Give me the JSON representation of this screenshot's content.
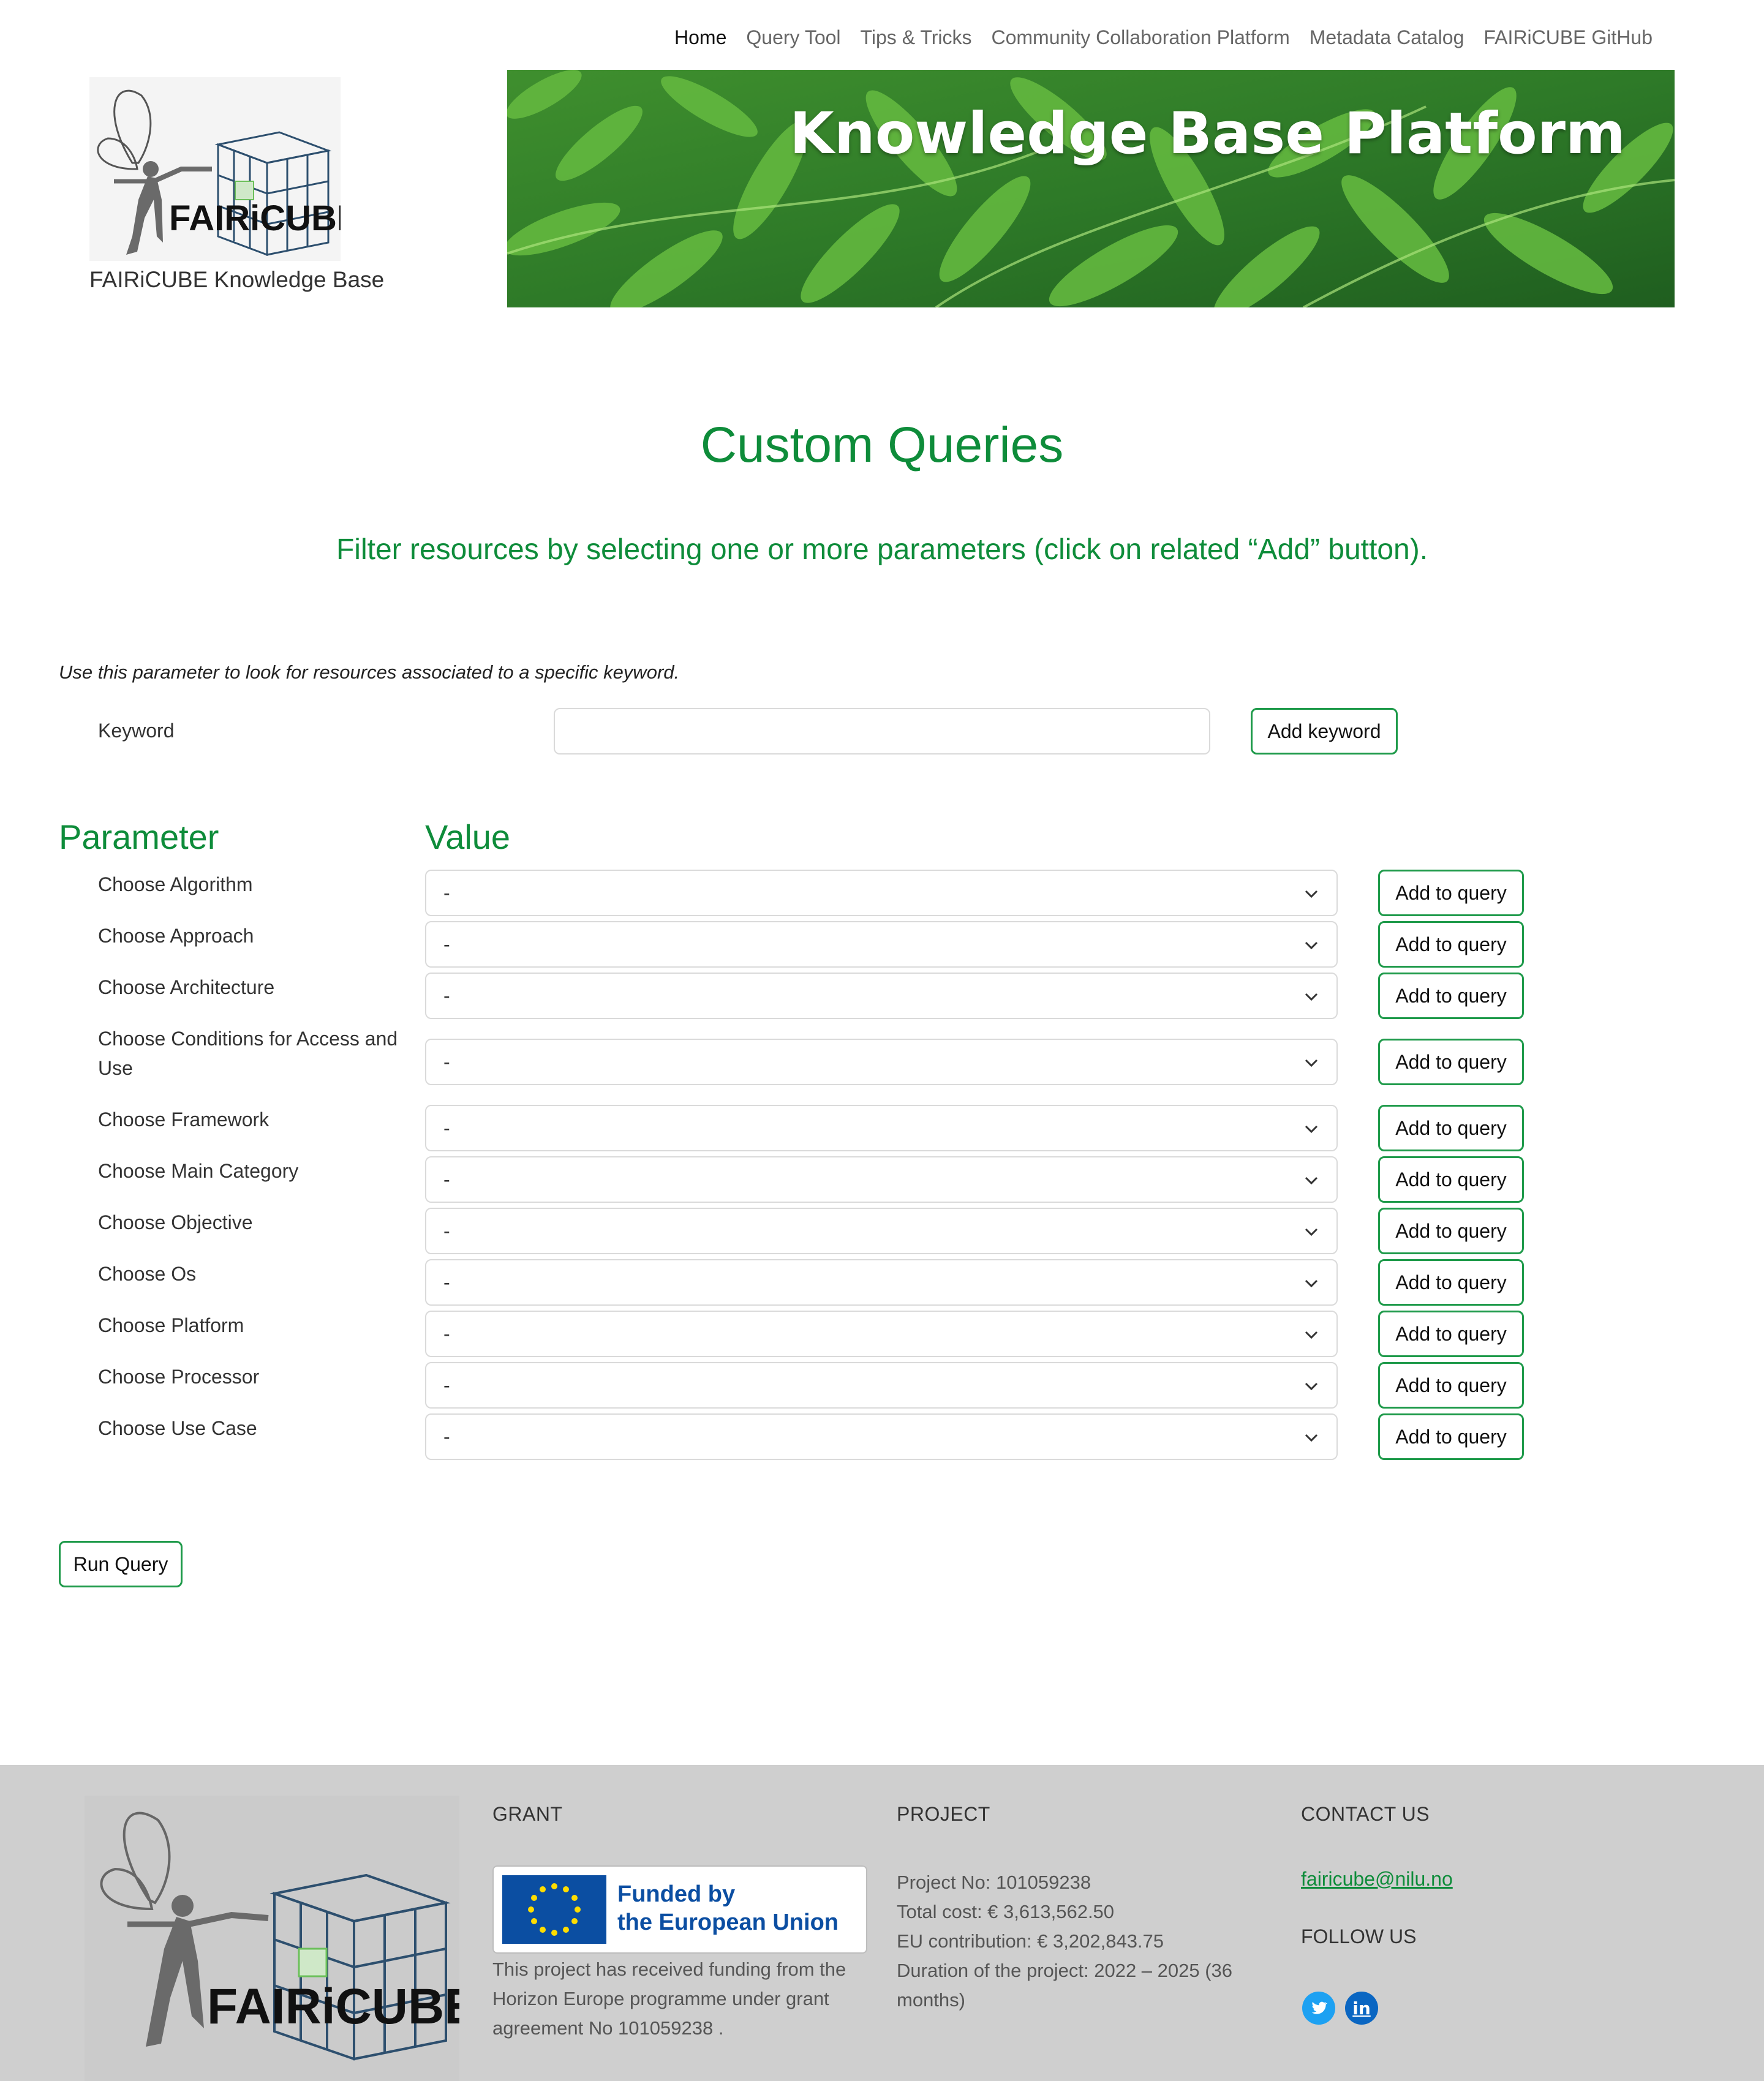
{
  "nav": {
    "items": [
      "Home",
      "Query Tool",
      "Tips & Tricks",
      "Community Collaboration Platform",
      "Metadata Catalog",
      "FAIRiCUBE GitHub"
    ]
  },
  "header": {
    "logo_text": "FAIRiCUBE",
    "site_name": "FAIRiCUBE Knowledge Base",
    "banner_title": "Knowledge Base Platform"
  },
  "main": {
    "title": "Custom Queries",
    "subtitle": "Filter resources by selecting one or more parameters (click on related “Add” button).",
    "keyword_help": "Use this parameter to look for resources associated to a specific keyword.",
    "keyword_label": "Keyword",
    "keyword_value": "",
    "add_keyword_label": "Add keyword",
    "col_parameter": "Parameter",
    "col_value": "Value",
    "parameters": [
      {
        "label": "Choose Algorithm",
        "value": "-",
        "button": "Add to query"
      },
      {
        "label": "Choose Approach",
        "value": "-",
        "button": "Add to query"
      },
      {
        "label": "Choose Architecture",
        "value": "-",
        "button": "Add to query"
      },
      {
        "label": "Choose Conditions for Access and Use",
        "value": "-",
        "button": "Add to query"
      },
      {
        "label": "Choose Framework",
        "value": "-",
        "button": "Add to query"
      },
      {
        "label": "Choose Main Category",
        "value": "-",
        "button": "Add to query"
      },
      {
        "label": "Choose Objective",
        "value": "-",
        "button": "Add to query"
      },
      {
        "label": "Choose Os",
        "value": "-",
        "button": "Add to query"
      },
      {
        "label": "Choose Platform",
        "value": "-",
        "button": "Add to query"
      },
      {
        "label": "Choose Processor",
        "value": "-",
        "button": "Add to query"
      },
      {
        "label": "Choose Use Case",
        "value": "-",
        "button": "Add to query"
      }
    ],
    "run_query_label": "Run Query"
  },
  "footer": {
    "logo_text": "FAIRiCUBE",
    "grant_heading": "GRANT",
    "eu_line1": "Funded by",
    "eu_line2": "the European Union",
    "grant_text": "This project has received funding from the Horizon Europe programme under grant agreement No 101059238 .",
    "project_heading": "PROJECT",
    "project_no": "Project No: 101059238",
    "total_cost": "Total cost: € 3,613,562.50",
    "eu_contribution": "EU contribution: € 3,202,843.75",
    "duration": "Duration of the project: 2022 – 2025 (36 months)",
    "contact_heading": "CONTACT US",
    "email": "fairicube@nilu.no",
    "follow_heading": "FOLLOW US",
    "social_icons": [
      "twitter-icon",
      "linkedin-icon"
    ]
  },
  "colors": {
    "accent_green": "#0e8c3a",
    "button_border": "#1e9a4a",
    "footer_bg": "#cfcfcf",
    "eu_blue": "#0b4ea2"
  }
}
